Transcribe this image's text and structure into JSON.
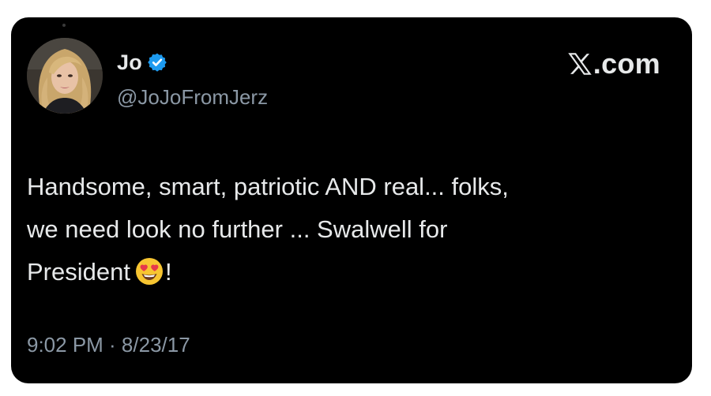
{
  "tweet": {
    "author": {
      "display_name": "Jo",
      "handle": "@JoJoFromJerz",
      "verified": true,
      "avatar": "profile-photo"
    },
    "brand": {
      "label": ".com",
      "logo": "x-logo"
    },
    "body": {
      "line1": "Handsome, smart, patriotic AND real... folks,",
      "line2": "we need look no further ... Swalwell for",
      "line3_text": "President",
      "line3_emoji": "heart-eyes-emoji",
      "line3_end": "!"
    },
    "timestamp": "9:02 PM · 8/23/17"
  },
  "colors": {
    "card_background": "#000000",
    "page_background": "#ffffff",
    "primary_text": "#e7e9ea",
    "secondary_text": "#8b98a5",
    "verified_badge": "#1d9bf0",
    "emoji_face": "#f7c531",
    "emoji_heart": "#e6394b"
  }
}
